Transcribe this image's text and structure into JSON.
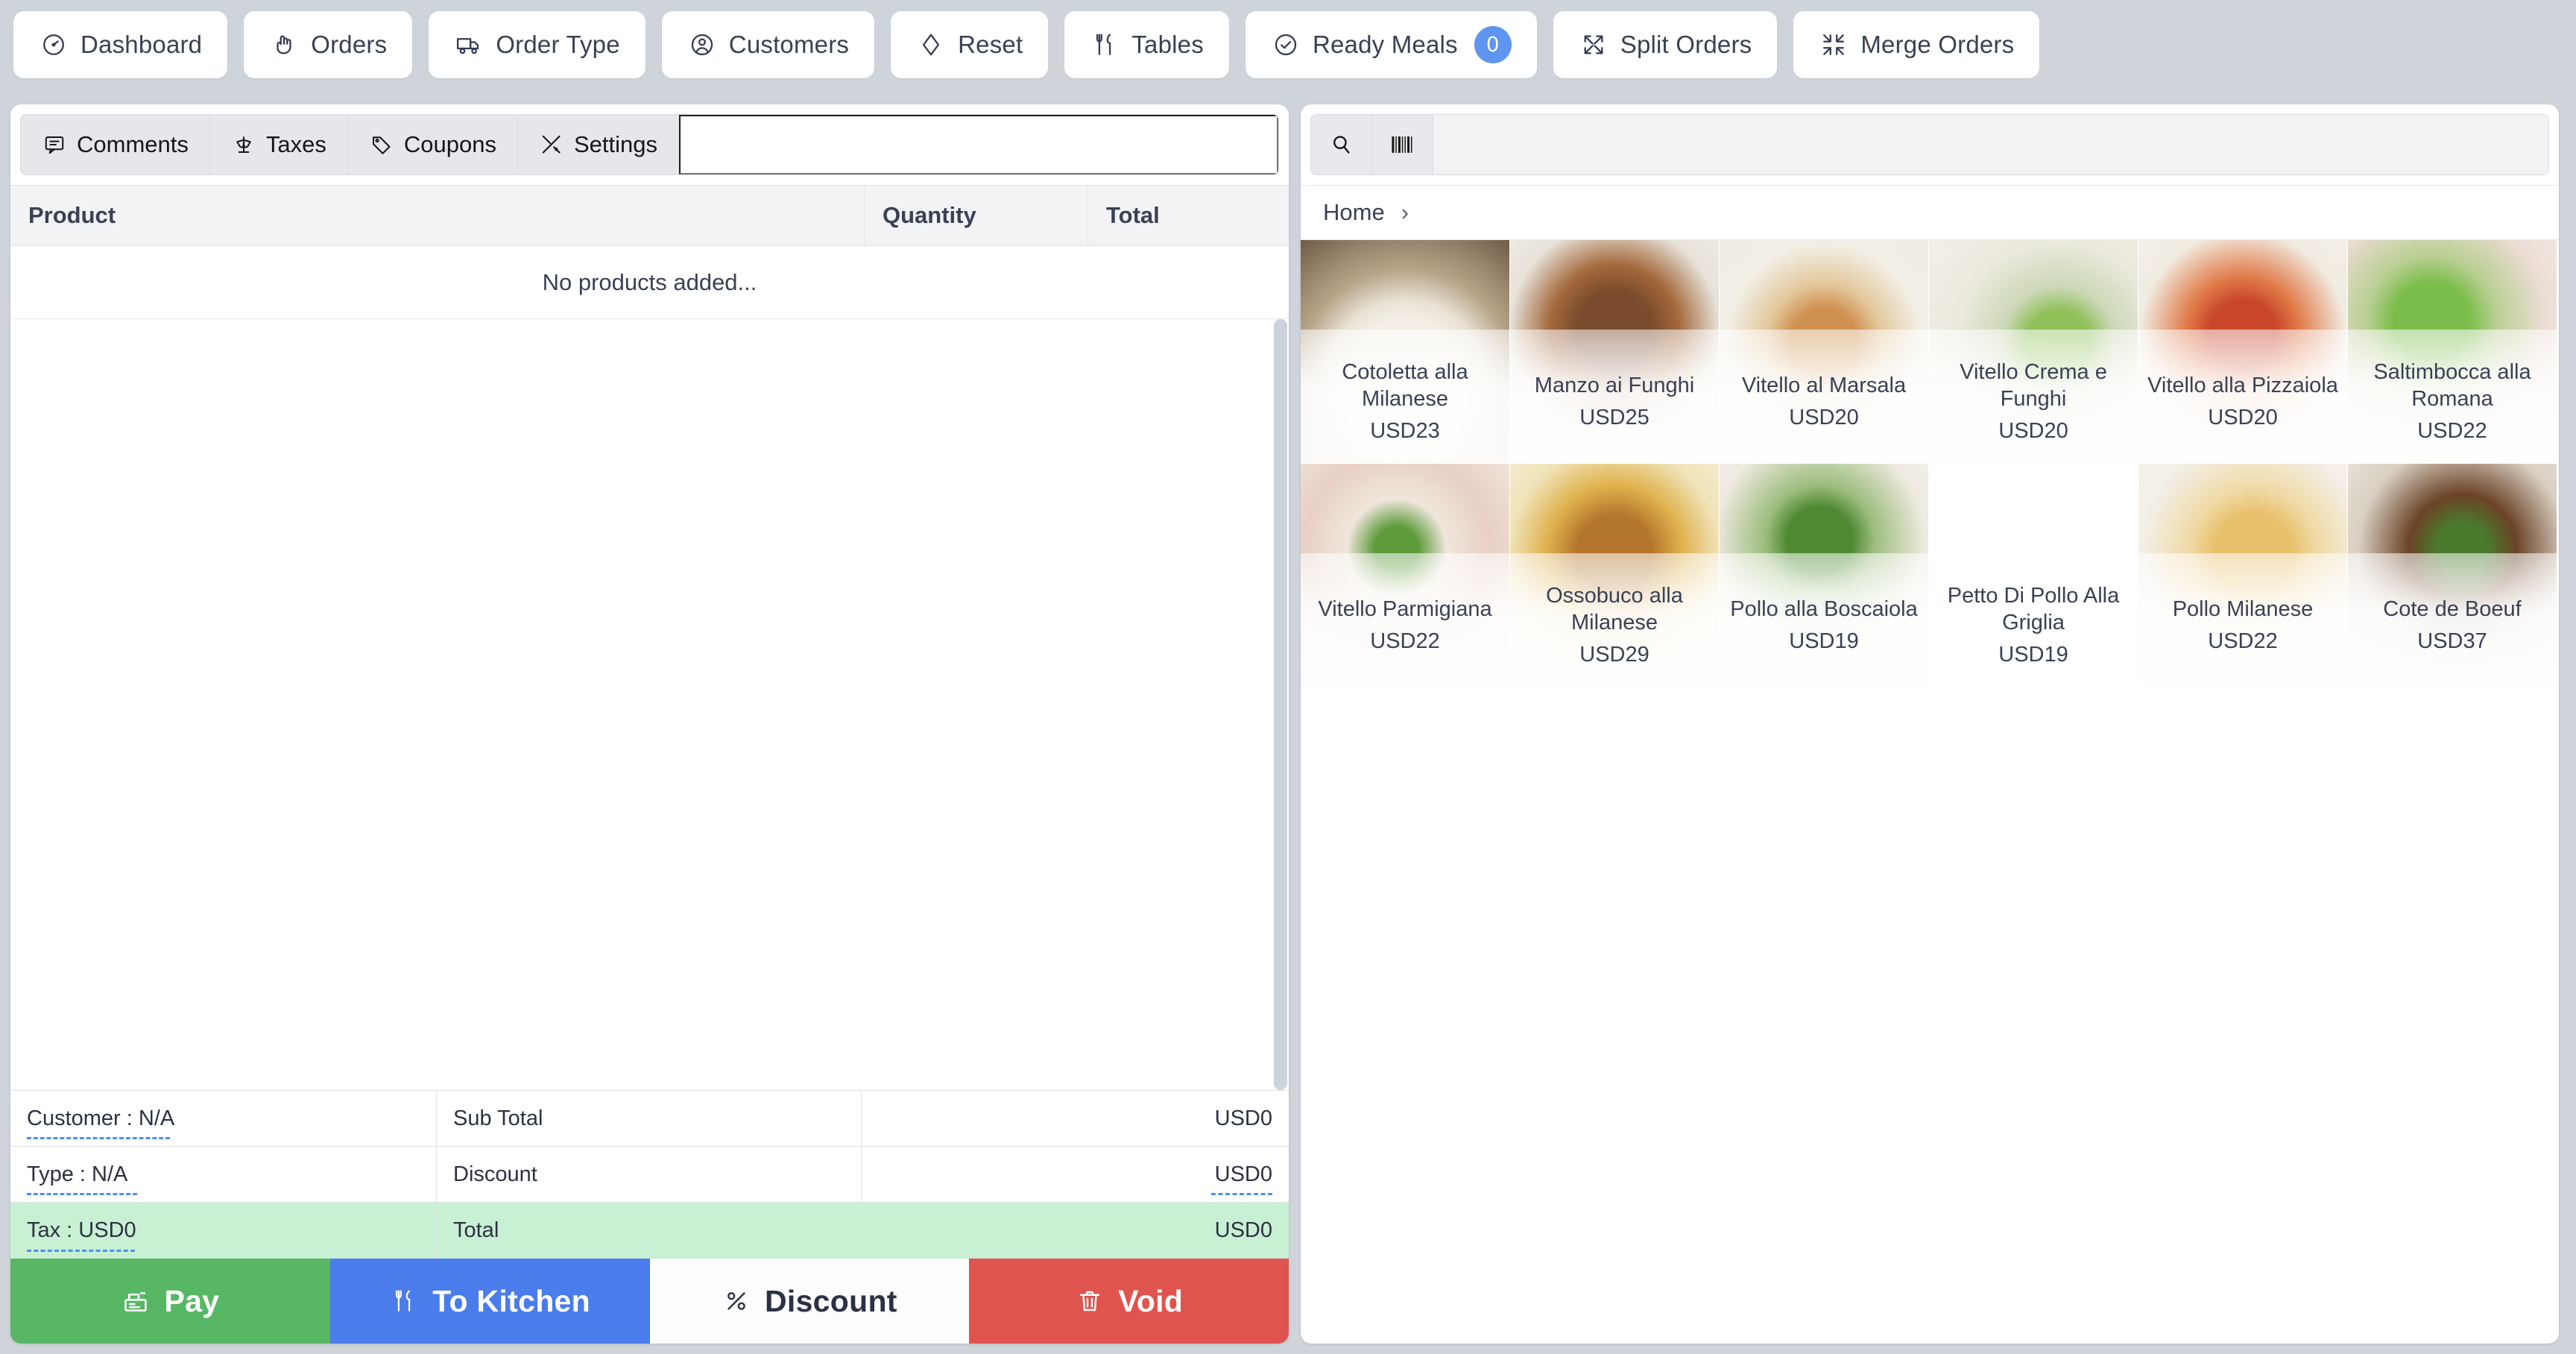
{
  "topnav": {
    "buttons": [
      {
        "label": "Dashboard",
        "icon": "gauge-icon"
      },
      {
        "label": "Orders",
        "icon": "hand-pointer-icon"
      },
      {
        "label": "Order Type",
        "icon": "truck-icon"
      },
      {
        "label": "Customers",
        "icon": "user-circle-icon"
      },
      {
        "label": "Reset",
        "icon": "diamond-icon"
      },
      {
        "label": "Tables",
        "icon": "cutlery-icon"
      },
      {
        "label": "Ready Meals",
        "icon": "check-circle-icon",
        "badge": "0"
      },
      {
        "label": "Split Orders",
        "icon": "split-arrows-icon"
      },
      {
        "label": "Merge Orders",
        "icon": "merge-arrows-icon"
      }
    ]
  },
  "colors": {
    "page_background": "#ced4da",
    "badge": "#5d95f0",
    "pay": "#58b765",
    "to_kitchen": "#4a7ceb",
    "void": "#e0544f",
    "total_row": "#c8f0d3",
    "dashed_underline": "#4d90f0"
  },
  "cart": {
    "tabs": [
      {
        "label": "Comments",
        "icon": "comment-icon"
      },
      {
        "label": "Taxes",
        "icon": "scales-icon"
      },
      {
        "label": "Coupons",
        "icon": "tag-icon"
      },
      {
        "label": "Settings",
        "icon": "tools-icon"
      }
    ],
    "comment_input_value": "",
    "comment_input_placeholder": "",
    "columns": [
      "Product",
      "Quantity",
      "Total"
    ],
    "empty_message": "No products added...",
    "rows": [],
    "summary": [
      {
        "info": "Customer : N/A",
        "label": "Sub Total",
        "value": "USD0",
        "highlight": false
      },
      {
        "info": "Type : N/A",
        "label": "Discount",
        "value": "USD0",
        "highlight": false
      },
      {
        "info": "Tax : USD0",
        "label": "Total",
        "value": "USD0",
        "highlight": true
      }
    ],
    "actions": [
      {
        "label": "Pay",
        "icon": "cash-register-icon"
      },
      {
        "label": "To Kitchen",
        "icon": "cutlery-icon"
      },
      {
        "label": "Discount",
        "icon": "percent-icon"
      },
      {
        "label": "Void",
        "icon": "trash-icon"
      }
    ]
  },
  "catalog": {
    "search_value": "",
    "search_placeholder": "",
    "search_icon": "magnifier-icon",
    "barcode_icon": "barcode-icon",
    "breadcrumb": [
      "Home"
    ],
    "breadcrumb_separator": "›",
    "products": [
      {
        "name": "Cotoletta alla Milanese",
        "price": "USD23"
      },
      {
        "name": "Manzo ai Funghi",
        "price": "USD25"
      },
      {
        "name": "Vitello al Marsala",
        "price": "USD20"
      },
      {
        "name": "Vitello Crema e Funghi",
        "price": "USD20"
      },
      {
        "name": "Vitello alla Pizzaiola",
        "price": "USD20"
      },
      {
        "name": "Saltimbocca alla Romana",
        "price": "USD22"
      },
      {
        "name": "Vitello Parmigiana",
        "price": "USD22"
      },
      {
        "name": "Ossobuco alla Milanese",
        "price": "USD29"
      },
      {
        "name": "Pollo alla Boscaiola",
        "price": "USD19"
      },
      {
        "name": "Petto Di Pollo Alla Griglia",
        "price": "USD19"
      },
      {
        "name": "Pollo Milanese",
        "price": "USD22"
      },
      {
        "name": "Cote de Boeuf",
        "price": "USD37"
      }
    ]
  }
}
